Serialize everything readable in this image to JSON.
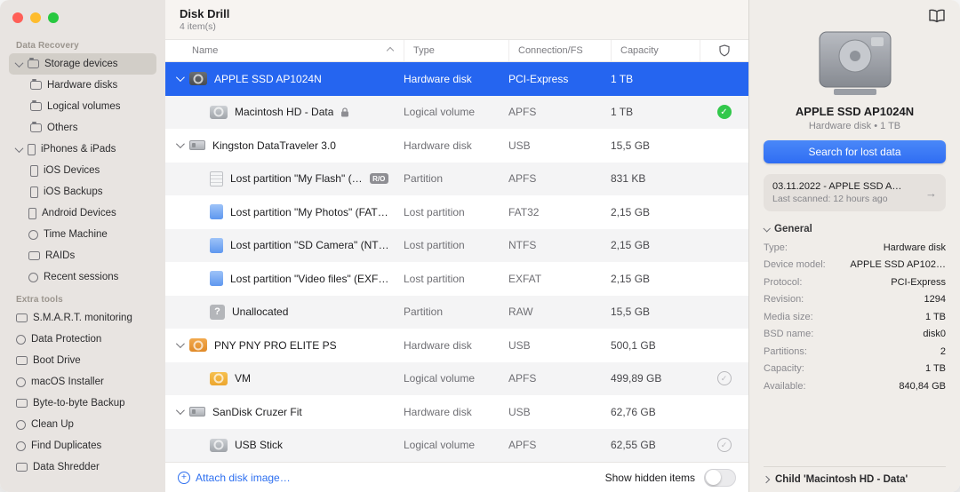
{
  "window": {
    "title": "Disk Drill",
    "items_count": "4 item(s)"
  },
  "sidebar": {
    "sections": [
      {
        "label": "Data Recovery",
        "items": [
          {
            "label": "Storage devices"
          },
          {
            "label": "Hardware disks"
          },
          {
            "label": "Logical volumes"
          },
          {
            "label": "Others"
          },
          {
            "label": "iPhones & iPads"
          },
          {
            "label": "iOS Devices"
          },
          {
            "label": "iOS Backups"
          },
          {
            "label": "Android Devices"
          },
          {
            "label": "Time Machine"
          },
          {
            "label": "RAIDs"
          },
          {
            "label": "Recent sessions"
          }
        ]
      },
      {
        "label": "Extra tools",
        "items": [
          {
            "label": "S.M.A.R.T. monitoring"
          },
          {
            "label": "Data Protection"
          },
          {
            "label": "Boot Drive"
          },
          {
            "label": "macOS Installer"
          },
          {
            "label": "Byte-to-byte Backup"
          },
          {
            "label": "Clean Up"
          },
          {
            "label": "Find Duplicates"
          },
          {
            "label": "Data Shredder"
          }
        ]
      }
    ]
  },
  "table": {
    "columns": {
      "name": "Name",
      "type": "Type",
      "connection": "Connection/FS",
      "capacity": "Capacity"
    },
    "rows": [
      {
        "name": "APPLE SSD AP1024N",
        "type": "Hardware disk",
        "fs": "PCI-Express",
        "capacity": "1 TB"
      },
      {
        "name": "Macintosh HD - Data",
        "type": "Logical volume",
        "fs": "APFS",
        "capacity": "1 TB"
      },
      {
        "name": "Kingston DataTraveler 3.0",
        "type": "Hardware disk",
        "fs": "USB",
        "capacity": "15,5 GB"
      },
      {
        "name": "Lost partition \"My Flash\" (…",
        "badge": "R/O",
        "type": "Partition",
        "fs": "APFS",
        "capacity": "831 KB"
      },
      {
        "name": "Lost partition \"My Photos\" (FAT…",
        "type": "Lost partition",
        "fs": "FAT32",
        "capacity": "2,15 GB"
      },
      {
        "name": "Lost partition \"SD Camera\" (NT…",
        "type": "Lost partition",
        "fs": "NTFS",
        "capacity": "2,15 GB"
      },
      {
        "name": "Lost partition \"Video files\" (EXF…",
        "type": "Lost partition",
        "fs": "EXFAT",
        "capacity": "2,15 GB"
      },
      {
        "name": "Unallocated",
        "type": "Partition",
        "fs": "RAW",
        "capacity": "15,5 GB"
      },
      {
        "name": "PNY PNY PRO ELITE PS",
        "type": "Hardware disk",
        "fs": "USB",
        "capacity": "500,1 GB"
      },
      {
        "name": "VM",
        "type": "Logical volume",
        "fs": "APFS",
        "capacity": "499,89 GB"
      },
      {
        "name": "SanDisk Cruzer Fit",
        "type": "Hardware disk",
        "fs": "USB",
        "capacity": "62,76 GB"
      },
      {
        "name": "USB Stick",
        "type": "Logical volume",
        "fs": "APFS",
        "capacity": "62,55 GB"
      }
    ]
  },
  "footer": {
    "attach_label": "Attach disk image…",
    "show_hidden_label": "Show hidden items"
  },
  "details": {
    "title": "APPLE SSD AP1024N",
    "subtitle": "Hardware disk • 1 TB",
    "search_button": "Search for lost data",
    "session": {
      "title": "03.11.2022 - APPLE SSD A…",
      "subtitle": "Last scanned: 12 hours ago",
      "arrow": "→"
    },
    "general": {
      "label": "General",
      "fields": [
        {
          "label": "Type:",
          "value": "Hardware disk"
        },
        {
          "label": "Device model:",
          "value": "APPLE SSD AP102…"
        },
        {
          "label": "Protocol:",
          "value": "PCI-Express"
        },
        {
          "label": "Revision:",
          "value": "1294"
        },
        {
          "label": "Media size:",
          "value": "1 TB"
        },
        {
          "label": "BSD name:",
          "value": "disk0"
        },
        {
          "label": "Partitions:",
          "value": "2"
        },
        {
          "label": "Capacity:",
          "value": "1 TB"
        },
        {
          "label": "Available:",
          "value": "840,84 GB"
        }
      ]
    },
    "child_label": "Child 'Macintosh HD - Data'"
  }
}
